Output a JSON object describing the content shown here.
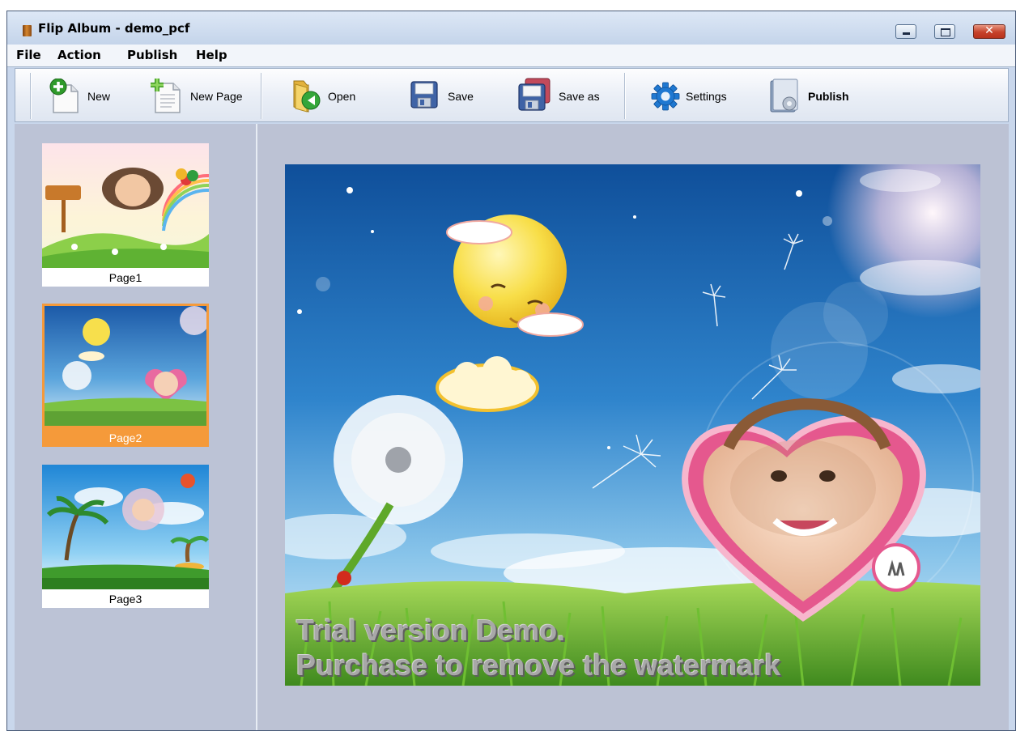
{
  "window": {
    "title": "Flip Album - demo_pcf",
    "controls": [
      "minimize",
      "maximize",
      "close"
    ],
    "close_glyph": "✕"
  },
  "menu": [
    "File",
    "Action",
    "Publish",
    "Help"
  ],
  "toolbar": {
    "new_label": "New",
    "new_page_label": "New Page",
    "open_label": "Open",
    "save_label": "Save",
    "save_as_label": "Save as",
    "settings_label": "Settings",
    "publish_label": "Publish"
  },
  "pages": [
    {
      "caption": "Page1",
      "selected": false
    },
    {
      "caption": "Page2",
      "selected": true
    },
    {
      "caption": "Page3",
      "selected": false
    }
  ],
  "watermark": {
    "line1": "Trial version Demo.",
    "line2": "Purchase to remove the watermark"
  },
  "colors": {
    "selection": "#f59a3a",
    "panel": "#bcc3d6",
    "sky": "#2a78c6"
  }
}
